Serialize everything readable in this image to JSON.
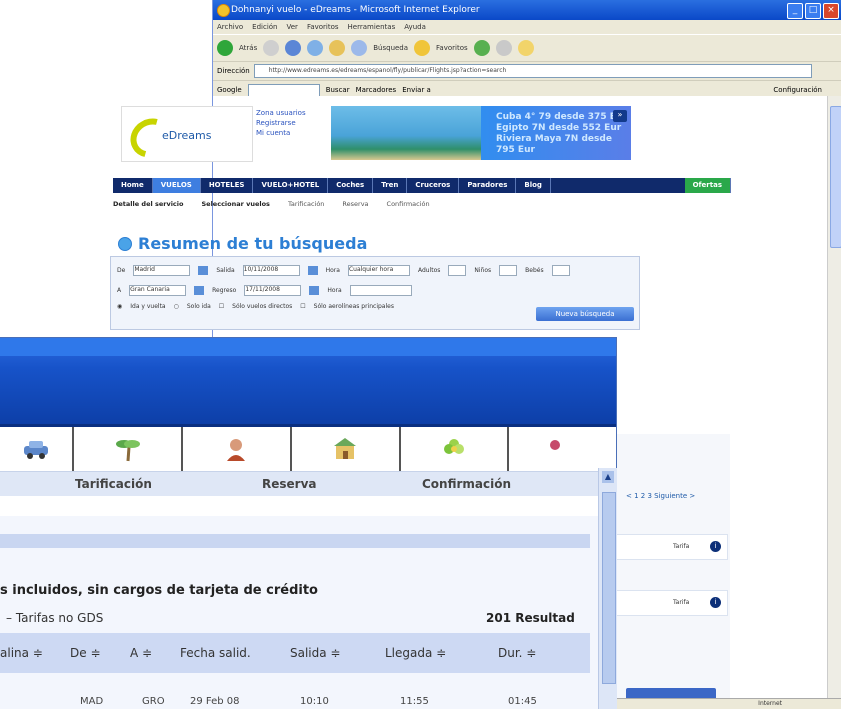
{
  "browser": {
    "title": "Dohnanyi vuelo - eDreams - Microsoft Internet Explorer",
    "menu": [
      "Archivo",
      "Edición",
      "Ver",
      "Favoritos",
      "Herramientas",
      "Ayuda"
    ],
    "toolbar": {
      "back": "Atrás",
      "search": "Búsqueda",
      "favorites": "Favoritos"
    },
    "address_label": "Dirección",
    "address_value": "http://www.edreams.es/edreams/espanol/fly/publicar/Flights.jsp?action=search",
    "google_label": "Google",
    "google_items": [
      "Buscar",
      "Marcadores",
      "Enviar a",
      "Configuración"
    ],
    "status_text": "Internet"
  },
  "site": {
    "logo_text": "eDreams",
    "header_links": [
      "Zona usuarios",
      "Registrarse",
      "Mi cuenta"
    ],
    "banner_offers": [
      "Cuba 4° 79 desde 375 Eur",
      "Egipto 7N desde 552 Eur",
      "Riviera Maya 7N desde 795 Eur"
    ],
    "nav": [
      "Home",
      "VUELOS",
      "HOTELES",
      "VUELO+HOTEL",
      "Coches",
      "Tren",
      "Cruceros",
      "Paradores",
      "Blog",
      "Ofertas"
    ],
    "steps": [
      "Detalle del servicio",
      "Seleccionar vuelos",
      "Tarificación",
      "Reserva",
      "Confirmación"
    ],
    "heading": "Resumen de tu búsqueda",
    "form": {
      "from_label": "De",
      "from_value": "Madrid",
      "to_label": "A",
      "to_value": "Gran Canaria",
      "depart_label": "Salida",
      "depart_value": "10/11/2008",
      "return_label": "Regreso",
      "return_value": "17/11/2008",
      "time_label": "Hora",
      "time_value": "Cualquier hora",
      "adults_label": "Adultos",
      "children_label": "Niños",
      "babies_label": "Bebés",
      "roundtrip_label": "Ida y vuelta",
      "oneway_label": "Solo ida",
      "direct_label": "Sólo vuelos directos",
      "lowcost_label": "Sólo aerolíneas principales",
      "submit": "Nueva búsqueda"
    },
    "right_panel": {
      "pager": "< 1 2 3 Siguiente >",
      "card1": "Tarifa",
      "card2": "Tarifa"
    }
  },
  "front": {
    "steps": [
      "Tarificación",
      "Reserva",
      "Confirmación"
    ],
    "note": "s incluidos, sin cargos de tarjeta de crédito",
    "link": "– Tarifas no GDS",
    "count": "201 Resultad",
    "columns": [
      "alina ≑",
      "De ≑",
      "A ≑",
      "Fecha salid.",
      "Salida ≑",
      "Llegada ≑",
      "Dur. ≑"
    ],
    "row": [
      "",
      "MAD",
      "GRO",
      "29 Feb 08",
      "10:10",
      "11:55",
      "01:45"
    ]
  }
}
